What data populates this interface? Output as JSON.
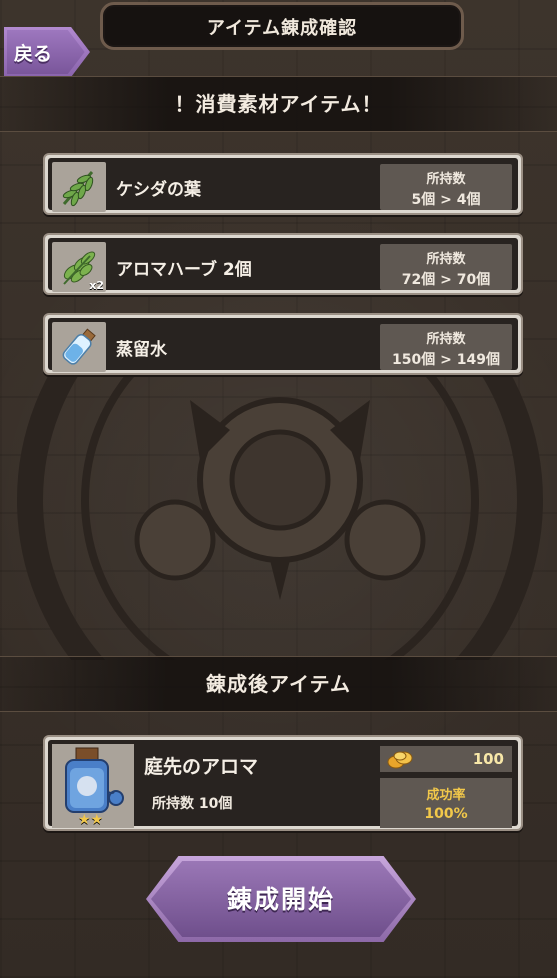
{
  "header": {
    "title": "アイテム錬成確認",
    "back_label": "戻る"
  },
  "materials_section": {
    "title": "！消費素材アイテム！"
  },
  "materials": [
    {
      "name": "ケシダの葉",
      "quantity_tag": "",
      "stock_label": "所持数",
      "stock_change": "5個 > 4個",
      "icon": "leaf-icon"
    },
    {
      "name": "アロマハーブ 2個",
      "quantity_tag": "x2",
      "stock_label": "所持数",
      "stock_change": "72個 > 70個",
      "icon": "herb-icon"
    },
    {
      "name": "蒸留水",
      "quantity_tag": "",
      "stock_label": "所持数",
      "stock_change": "150個 > 149個",
      "icon": "water-vial-icon"
    }
  ],
  "result_section": {
    "title": "錬成後アイテム"
  },
  "result": {
    "name": "庭先のアロマ",
    "owned": "所持数 10個",
    "stars": "★★",
    "cost": "100",
    "success_label": "成功率",
    "success_rate": "100%",
    "icon": "aroma-bottle-icon",
    "cost_icon": "gold-coins-icon"
  },
  "actions": {
    "start_label": "錬成開始"
  },
  "colors": {
    "accent_purple": "#9a77b6",
    "panel_dark": "#282320",
    "panel_frame": "#ddd8d0",
    "gold_text": "#f2c84a"
  }
}
